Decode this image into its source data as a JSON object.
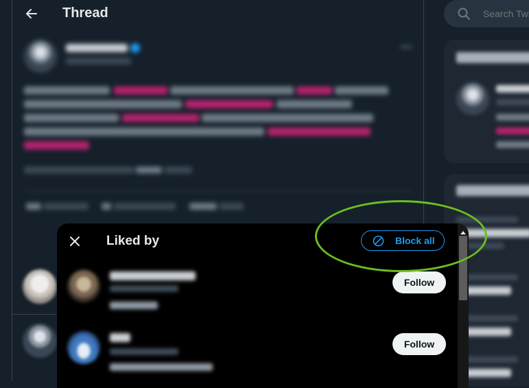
{
  "header": {
    "title": "Thread"
  },
  "search": {
    "placeholder": "Search Twitter"
  },
  "modal": {
    "title": "Liked by",
    "block_all_label": "Block all",
    "users": [
      {
        "follow_label": "Follow"
      },
      {
        "follow_label": "Follow"
      }
    ]
  },
  "colors": {
    "accent": "#1d9bf0",
    "background": "#15202b",
    "highlight_ring": "#6bbf1f"
  }
}
